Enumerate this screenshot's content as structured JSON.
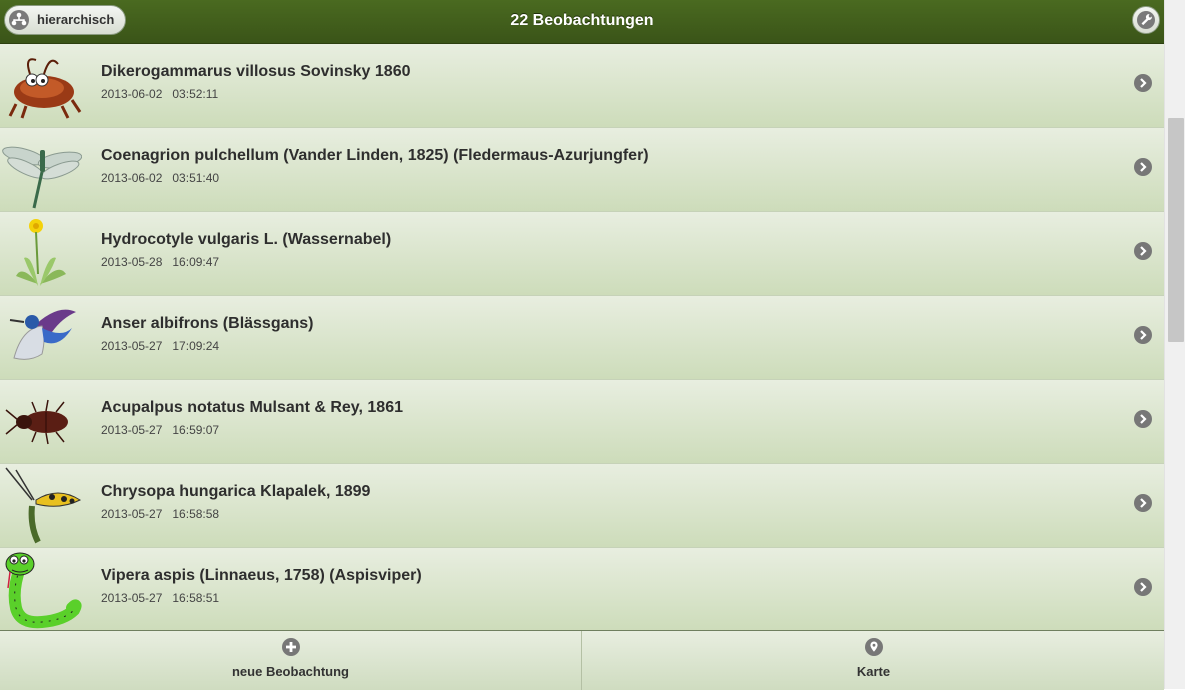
{
  "header": {
    "title": "22 Beobachtungen",
    "hier_button_label": "hierarchisch"
  },
  "observations": [
    {
      "name": "Dikerogammarus villosus Sovinsky 1860",
      "date": "2013-06-02   03:52:11",
      "icon": "amphipod-image"
    },
    {
      "name": "Coenagrion pulchellum (Vander Linden, 1825) (Fledermaus-Azurjungfer)",
      "date": "2013-06-02   03:51:40",
      "icon": "damselfly-image"
    },
    {
      "name": "Hydrocotyle vulgaris L. (Wassernabel)",
      "date": "2013-05-28   16:09:47",
      "icon": "plant-image"
    },
    {
      "name": "Anser albifrons (Blässgans)",
      "date": "2013-05-27   17:09:24",
      "icon": "bird-image"
    },
    {
      "name": "Acupalpus notatus Mulsant & Rey, 1861",
      "date": "2013-05-27   16:59:07",
      "icon": "beetle-image"
    },
    {
      "name": "Chrysopa hungarica Klapalek, 1899",
      "date": "2013-05-27   16:58:58",
      "icon": "lacewing-image"
    },
    {
      "name": "Vipera aspis (Linnaeus, 1758) (Aspisviper)",
      "date": "2013-05-27   16:58:51",
      "icon": "snake-image"
    }
  ],
  "footer": {
    "new_label": "neue Beobachtung",
    "map_label": "Karte"
  },
  "colors": {
    "header_green": "#3f5a1b",
    "row_gradient_top": "#e8eee0",
    "row_gradient_bottom": "#cddcba"
  }
}
